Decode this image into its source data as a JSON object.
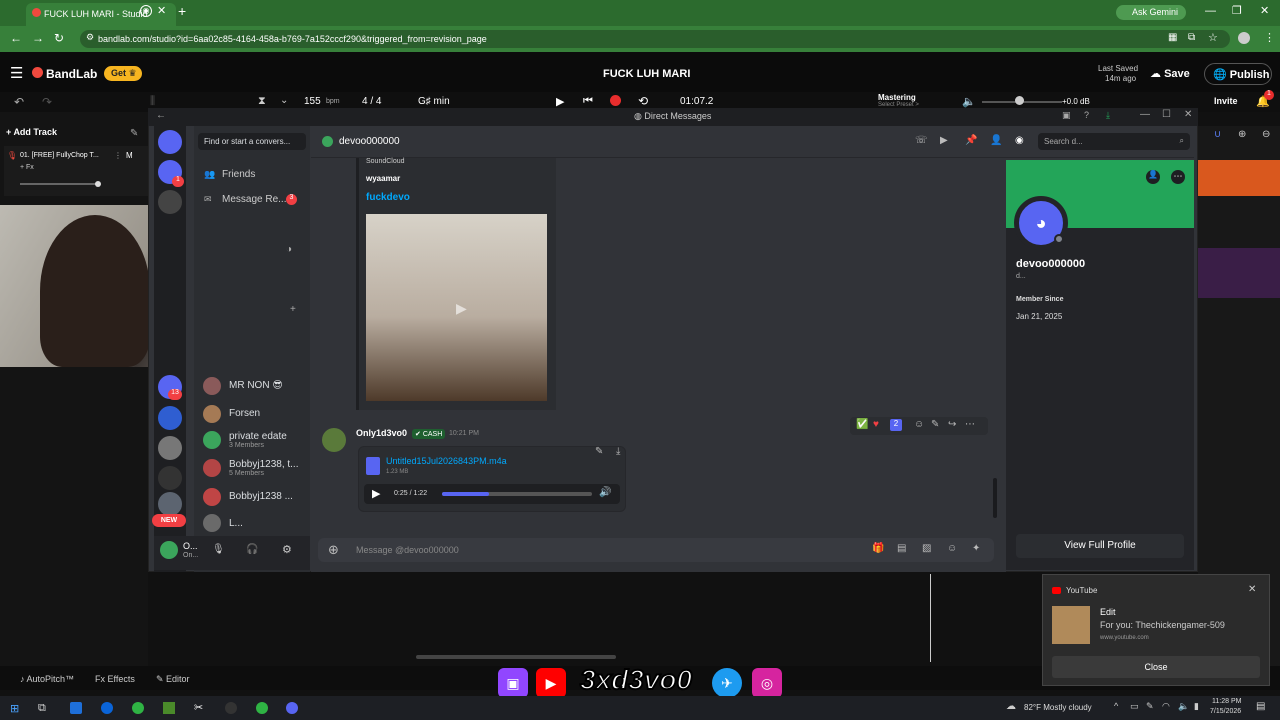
{
  "browser": {
    "tab_title": "FUCK LUH MARI - Studio",
    "url": "bandlab.com/studio?id=6aa02c85-4164-458a-b769-7a152cccf290&triggered_from=revision_page",
    "ask_gemini": "Ask Gemini"
  },
  "bandlab": {
    "logo": "BandLab",
    "get_button": "Get",
    "project_title": "FUCK LUH MARI",
    "last_saved_line1": "Last Saved",
    "last_saved_line2": "14m ago",
    "save": "Save",
    "publish": "Publish",
    "bpm_value": "155",
    "bpm_unit": "bpm",
    "time_signature": "4 / 4",
    "key": "G♯ min",
    "timecode": "01:07.2",
    "mastering": "Mastering",
    "mastering_sub": "Select Preset >",
    "volume_db": "+0.0 dB",
    "invite": "Invite",
    "notif_count": "1",
    "add_track": "Add Track",
    "track_name": "01. [FREE] FullyChop T...",
    "track_m": "M",
    "track_fx": "+ Fx",
    "autopitch": "AutoPitch™",
    "effects": "Effects",
    "editor": "Editor"
  },
  "discord": {
    "window_title": "Direct Messages",
    "search_dm": "Find or start a convers...",
    "friends": "Friends",
    "message_requests": "Message Re...",
    "message_requests_count": "3",
    "header_user": "devoo000000",
    "search_placeholder": "Search d...",
    "dms": [
      {
        "name": "MR NON 😎",
        "sub": ""
      },
      {
        "name": "Forsen",
        "sub": ""
      },
      {
        "name": "private edate",
        "sub": "3 Members"
      },
      {
        "name": "Bobbyj1238, t...",
        "sub": "5 Members"
      },
      {
        "name": "Bobbyj1238 ...",
        "sub": ""
      },
      {
        "name": "L...",
        "sub": ""
      }
    ],
    "server_badges": [
      "1",
      "1",
      "13"
    ],
    "new_badge": "NEW",
    "self_name": "O...",
    "self_status": "On...",
    "embed_provider": "SoundCloud",
    "embed_author": "wyaamar",
    "embed_title": "fuckdevo",
    "message_author": "Only1d3vo0",
    "message_tag": "CASH",
    "message_time": "10:21 PM",
    "reaction_count": "2",
    "attachment_name": "Untitled15Jul2026843PM.m4a",
    "attachment_size": "1.23 MB",
    "audio_time": "0:25 / 1:22",
    "audio_progress": 0.31,
    "message_placeholder": "Message @devoo000000",
    "profile_name": "devoo000000",
    "profile_sub": "d...",
    "member_since_label": "Member Since",
    "member_since": "Jan 21, 2025",
    "view_full_profile": "View Full Profile"
  },
  "overlay": {
    "handle": "3xd3vo0"
  },
  "notification": {
    "app": "YouTube",
    "title": "Edit",
    "body": "For you: Thechickengamer-509",
    "site": "www.youtube.com",
    "close": "Close"
  },
  "taskbar": {
    "weather": "82°F Mostly cloudy",
    "time": "11:28 PM",
    "date": "7/15/2026"
  },
  "colors": {
    "chrome_green": "#37803a",
    "discord_blurple": "#5865f2",
    "discord_bg": "#313338",
    "profile_banner": "#23a559",
    "bandlab_red": "#f0493e",
    "get_yellow": "#f7b520"
  }
}
